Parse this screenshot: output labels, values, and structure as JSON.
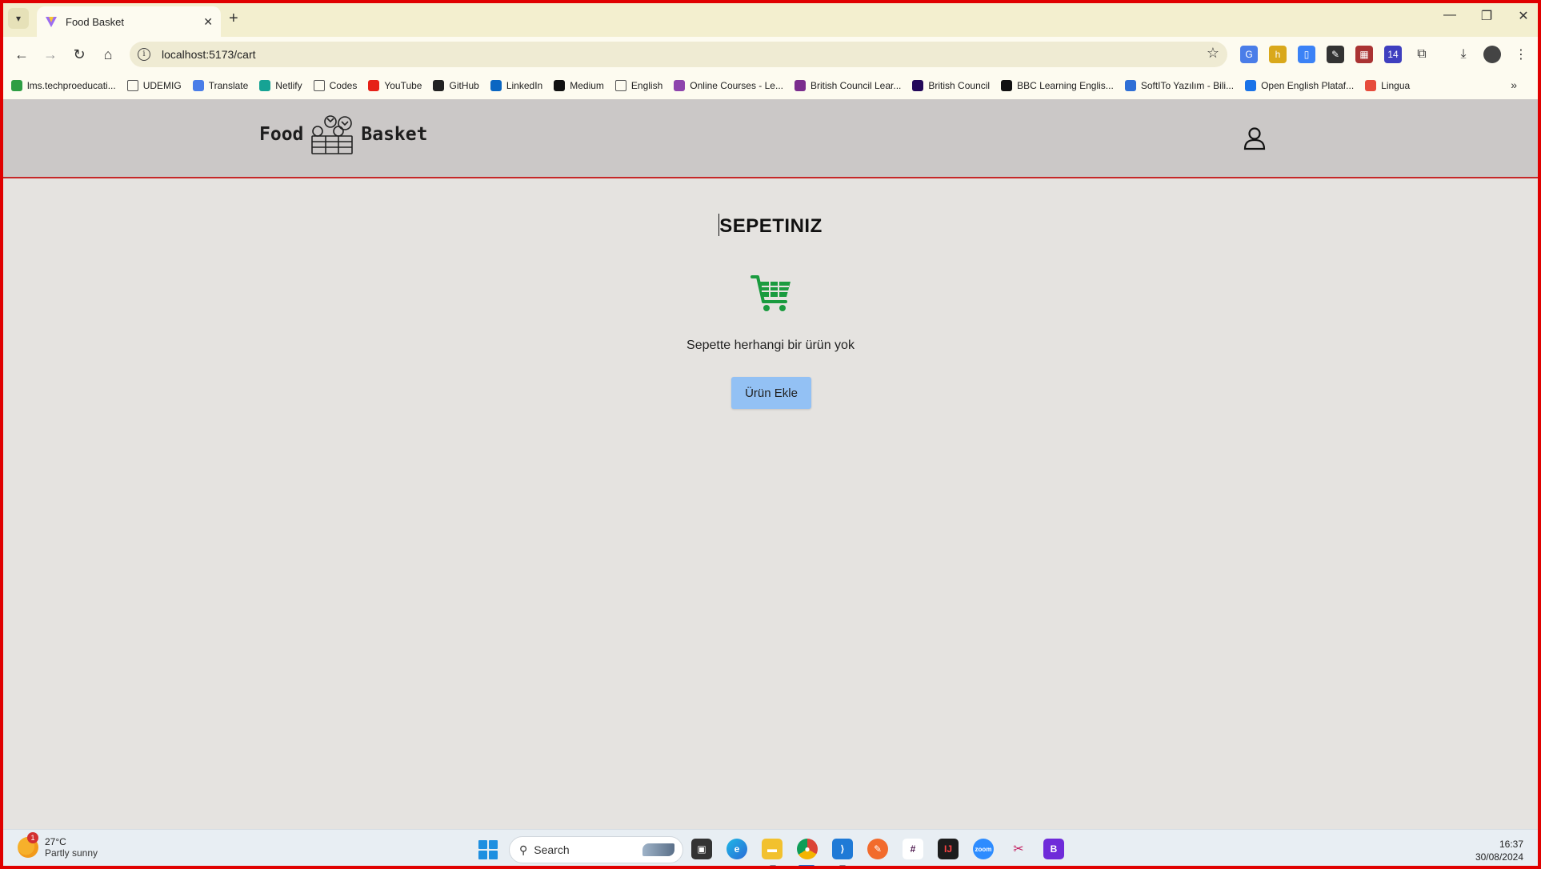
{
  "browser": {
    "tab_title": "Food Basket",
    "url": "localhost:5173/cart",
    "bookmarks": [
      {
        "label": "lms.techproeducati...",
        "icon": "check-circle-icon",
        "color": "#2e9e44"
      },
      {
        "label": "UDEMIG",
        "icon": "folder-icon",
        "color": "#555555"
      },
      {
        "label": "Translate",
        "icon": "translate-icon",
        "color": "#4a7de8"
      },
      {
        "label": "Netlify",
        "icon": "netlify-icon",
        "color": "#16a394"
      },
      {
        "label": "Codes",
        "icon": "folder-icon",
        "color": "#555555"
      },
      {
        "label": "YouTube",
        "icon": "youtube-icon",
        "color": "#e62117"
      },
      {
        "label": "GitHub",
        "icon": "github-icon",
        "color": "#222222"
      },
      {
        "label": "LinkedIn",
        "icon": "linkedin-icon",
        "color": "#0a66c2"
      },
      {
        "label": "Medium",
        "icon": "medium-icon",
        "color": "#111111"
      },
      {
        "label": "English",
        "icon": "folder-icon",
        "color": "#555555"
      },
      {
        "label": "Online Courses - Le...",
        "icon": "online-courses-icon",
        "color": "#8e44ad"
      },
      {
        "label": "British Council Lear...",
        "icon": "british-council-icon",
        "color": "#7b2d8e"
      },
      {
        "label": "British Council",
        "icon": "british-council-icon",
        "color": "#23085a"
      },
      {
        "label": "BBC Learning Englis...",
        "icon": "bbc-icon",
        "color": "#111111"
      },
      {
        "label": "SoftITo Yazılım - Bili...",
        "icon": "softito-icon",
        "color": "#2f6fd6"
      },
      {
        "label": "Open English Plataf...",
        "icon": "open-english-icon",
        "color": "#1a73e8"
      },
      {
        "label": "Lingua",
        "icon": "lingua-icon",
        "color": "#e74c3c"
      }
    ]
  },
  "header": {
    "brand_left": "Food",
    "brand_right": "Basket"
  },
  "cart": {
    "title": "SEPETINIZ",
    "empty_message": "Sepette herhangi bir ürün yok",
    "add_button": "Ürün Ekle",
    "cart_icon_color": "#1a9b3f",
    "button_color": "#93c1f4"
  },
  "taskbar": {
    "weather_temp": "27°C",
    "weather_desc": "Partly sunny",
    "weather_badge": "1",
    "search_label": "Search",
    "time": "16:37",
    "date": "30/08/2024"
  }
}
